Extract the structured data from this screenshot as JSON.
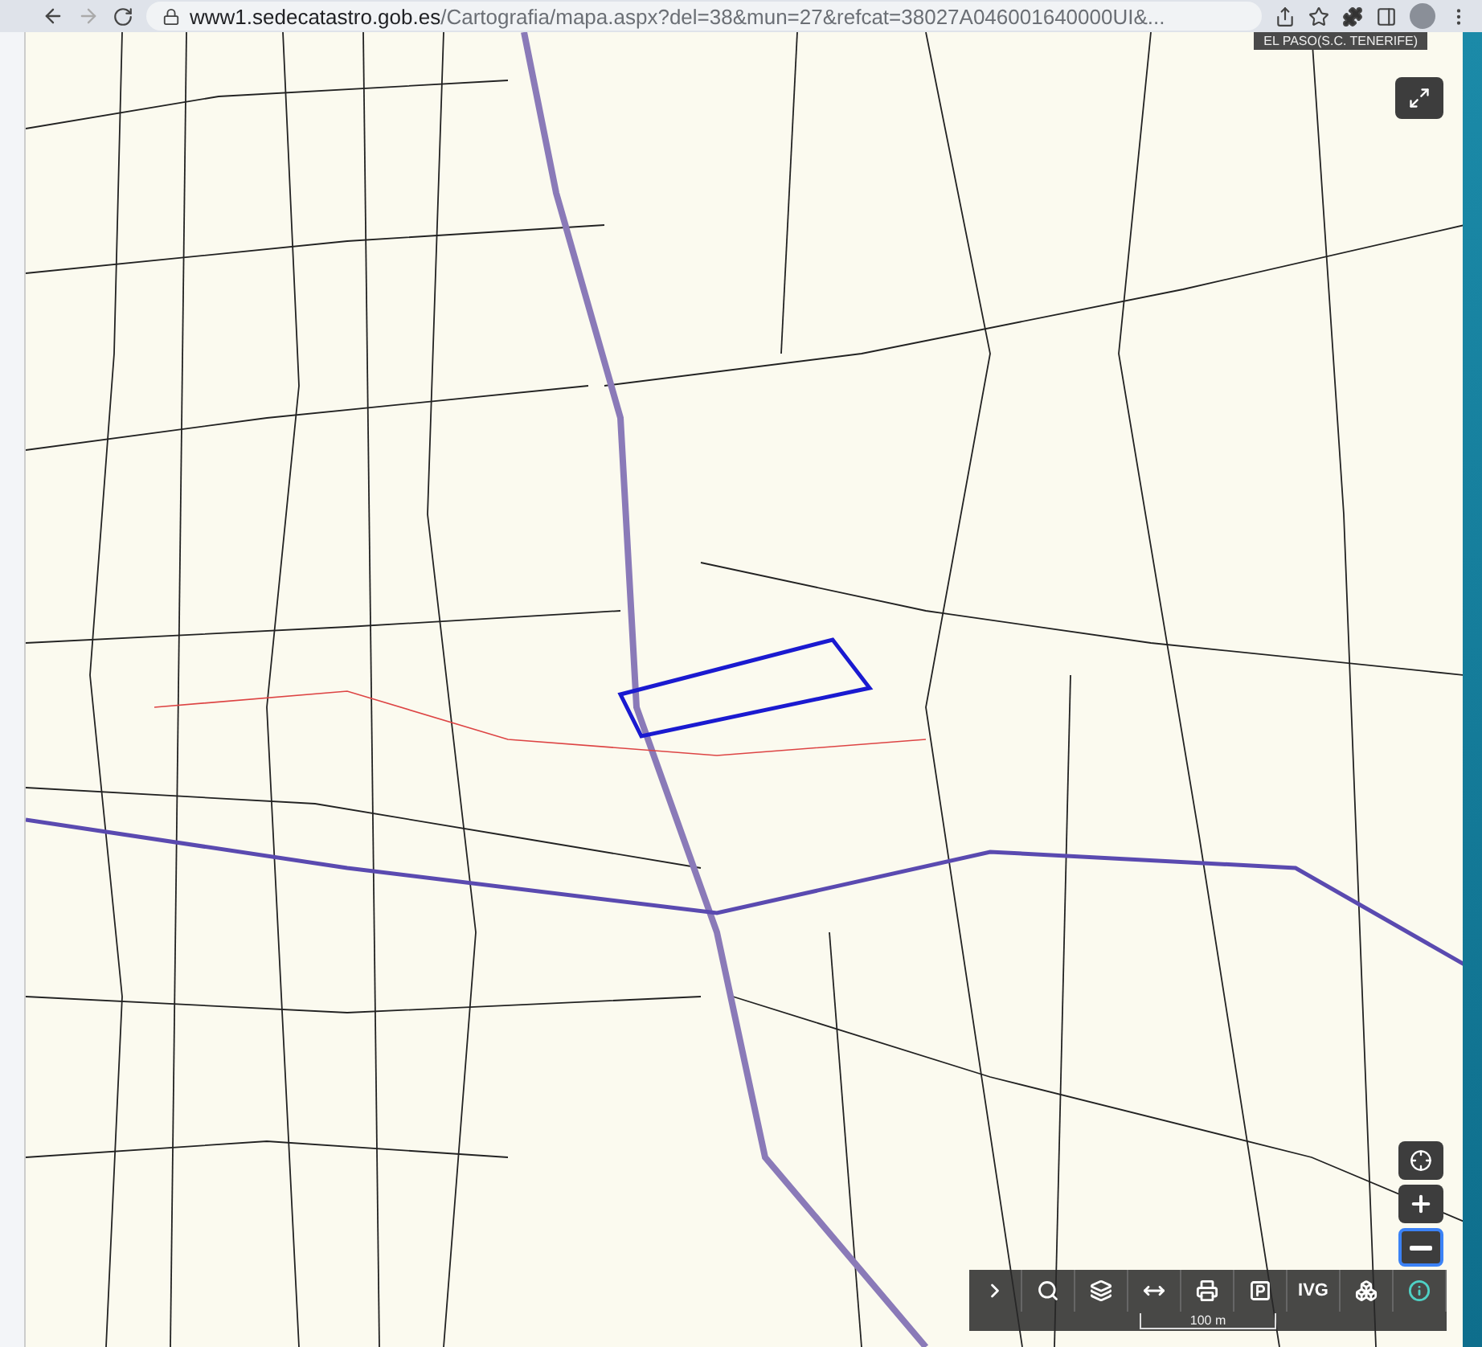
{
  "browser": {
    "url_host": "www1.sedecatastro.gob.es",
    "url_path": "/Cartografia/mapa.aspx?del=38&mun=27&refcat=38027A046001640000UI&..."
  },
  "map": {
    "region_label": "EL PASO(S.C. TENERIFE)",
    "scale": "100 m"
  },
  "zoom_controls": [
    {
      "kind": "locate",
      "selected": false
    },
    {
      "kind": "zoom-in",
      "selected": false
    },
    {
      "kind": "zoom-out",
      "selected": true
    }
  ],
  "toolbar": [
    {
      "kind": "chevron"
    },
    {
      "kind": "search"
    },
    {
      "kind": "layers"
    },
    {
      "kind": "measure"
    },
    {
      "kind": "print"
    },
    {
      "kind": "parking"
    },
    {
      "kind": "label",
      "label": "IVG"
    },
    {
      "kind": "group"
    },
    {
      "kind": "info"
    }
  ]
}
